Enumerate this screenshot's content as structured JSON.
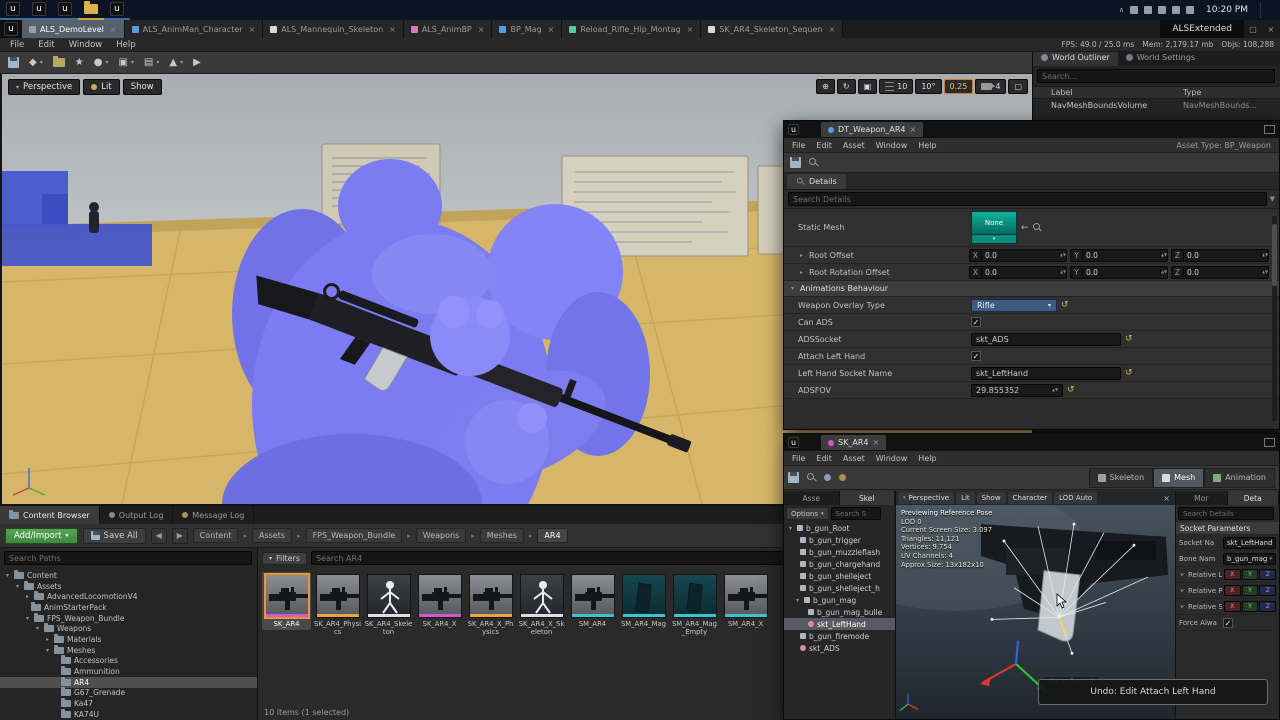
{
  "taskbar": {
    "clock": "10:20 PM",
    "window_title": "ALSExtended"
  },
  "editor_tabs": [
    {
      "label": "ALS_DemoLevel"
    },
    {
      "label": "ALS_AnimMan_Character"
    },
    {
      "label": "ALS_Mannequin_Skeleton"
    },
    {
      "label": "ALS_AnimBP"
    },
    {
      "label": "BP_Mag"
    },
    {
      "label": "Reload_Rifle_Hip_Montag"
    },
    {
      "label": "SK_AR4_Skeleton_Sequen"
    }
  ],
  "menu": [
    "File",
    "Edit",
    "Window",
    "Help"
  ],
  "perf": {
    "fps": "FPS: 49.0 / 25.0 ms",
    "mem": "Mem: 2,179.17 mb",
    "objs": "Objs: 108,288"
  },
  "viewport": {
    "perspective": "Perspective",
    "lit": "Lit",
    "show": "Show",
    "grid_snap": "10",
    "rot_snap": "10°",
    "scale_snap": "0.25",
    "camera_speed": "4"
  },
  "world_outliner": {
    "tab_outliner": "World Outliner",
    "tab_settings": "World Settings",
    "search_placeholder": "Search...",
    "col_label": "Label",
    "col_type": "Type",
    "rows": [
      {
        "label": "NavMeshBoundsVolume",
        "type": "NavMeshBounds..."
      }
    ]
  },
  "dt_window": {
    "title": "DT_Weapon_AR4",
    "menu": [
      "File",
      "Edit",
      "Asset",
      "Window",
      "Help"
    ],
    "asset_type": "Asset Type: BP_Weapon",
    "details_tab": "Details",
    "search_placeholder": "Search Details",
    "static_mesh_label": "Static Mesh",
    "static_mesh_value": "None",
    "root_offset_label": "Root Offset",
    "root_rotation_label": "Root Rotation Offset",
    "axes": [
      {
        "axis": "X",
        "value": "0.0"
      },
      {
        "axis": "Y",
        "value": "0.0"
      },
      {
        "axis": "Z",
        "value": "0.0"
      }
    ],
    "section_header": "Animations Behaviour",
    "rows": [
      {
        "label": "Weapon Overlay Type",
        "value": "Rifle"
      },
      {
        "label": "Can ADS"
      },
      {
        "label": "ADSSocket",
        "value": "skt_ADS"
      },
      {
        "label": "Attach Left Hand"
      },
      {
        "label": "Left Hand Socket Name",
        "value": "skt_LeftHand"
      },
      {
        "label": "ADSFOV",
        "value": "29.855352"
      }
    ]
  },
  "sk_window": {
    "title": "SK_AR4",
    "menu": [
      "File",
      "Edit",
      "Asset",
      "Window",
      "Help"
    ],
    "mode_tabs": [
      "Skeleton",
      "Mesh",
      "Animation"
    ],
    "left_tabs": [
      "Asse",
      "Skel"
    ],
    "options_label": "Options",
    "search_placeholder": "Search S",
    "bones": [
      {
        "label": "b_gun_Root"
      },
      {
        "label": "b_gun_trigger"
      },
      {
        "label": "b_gun_muzzleflash"
      },
      {
        "label": "b_gun_chargehand"
      },
      {
        "label": "b_gun_shelleject"
      },
      {
        "label": "b_gun_shelleject_h"
      },
      {
        "label": "b_gun_mag"
      },
      {
        "label": "b_gun_mag_bulle"
      },
      {
        "label": "skt_LeftHand"
      },
      {
        "label": "b_gun_firemode"
      },
      {
        "label": "skt_ADS"
      }
    ],
    "viewport_tabs": [
      "Perspective",
      "Lit",
      "Show",
      "Character",
      "LOD Auto"
    ],
    "overlay": [
      "Previewing Reference Pose",
      "LOD 0",
      "Current Screen Size: 3.097",
      "Triangles: 11,121",
      "Vertices: 9,754",
      "UV Channels: 4",
      "Approx Size: 13x182x10"
    ],
    "bone_label": "skt_LeftHand",
    "right_tabs": [
      "Mor",
      "Deta"
    ],
    "search_details_placeholder": "Search Details",
    "socket_header": "Socket Parameters",
    "socket_rows": [
      {
        "label": "Socket Na",
        "value": "skt_LeftHand"
      },
      {
        "label": "Bone Nam",
        "value": "b_gun_mag"
      },
      {
        "label": "Relative Lo"
      },
      {
        "label": "Relative Ro"
      },
      {
        "label": "Relative Sc"
      },
      {
        "label": "Force Alwa"
      }
    ]
  },
  "toast": {
    "text": "Undo: Edit Attach Left Hand"
  },
  "content_browser": {
    "tabs": [
      "Content Browser",
      "Output Log",
      "Message Log"
    ],
    "add_import": "Add/Import",
    "save_all": "Save All",
    "breadcrumbs": [
      "Content",
      "Assets",
      "FPS_Weapon_Bundle",
      "Weapons",
      "Meshes",
      "AR4"
    ],
    "search_paths_placeholder": "Search Paths",
    "folders": [
      {
        "label": "Content"
      },
      {
        "label": "Assets"
      },
      {
        "label": "AdvancedLocomotionV4"
      },
      {
        "label": "AnimStarterPack"
      },
      {
        "label": "FPS_Weapon_Bundle"
      },
      {
        "label": "Weapons"
      },
      {
        "label": "Materials"
      },
      {
        "label": "Meshes"
      },
      {
        "label": "Accessories"
      },
      {
        "label": "Ammunition"
      },
      {
        "label": "AR4"
      },
      {
        "label": "G67_Grenade"
      },
      {
        "label": "Ka47"
      },
      {
        "label": "KA74U"
      }
    ],
    "filters_label": "Filters",
    "search_assets_placeholder": "Search AR4",
    "assets": [
      {
        "name": "SK_AR4",
        "type": "skeletal"
      },
      {
        "name": "SK_AR4_Physics",
        "type": "physics"
      },
      {
        "name": "SK_AR4_Skeleton",
        "type": "skeleton"
      },
      {
        "name": "SK_AR4_X",
        "type": "skeletal"
      },
      {
        "name": "SK_AR4_X_Physics",
        "type": "physics"
      },
      {
        "name": "SK_AR4_X_Skeleton",
        "type": "skeleton"
      },
      {
        "name": "SM_AR4",
        "type": "static"
      },
      {
        "name": "SM_AR4_Mag",
        "type": "static"
      },
      {
        "name": "SM_AR4_Mag_Empty",
        "type": "static"
      },
      {
        "name": "SM_AR4_X",
        "type": "static"
      }
    ],
    "status": "10 items (1 selected)"
  },
  "colors": {
    "selection_orange": "#e8962e",
    "asset_skeletal": "#d257d2",
    "asset_physics": "#e8a33d",
    "asset_skeleton": "#dcdce8",
    "asset_static": "#3fc1d3",
    "viewport_character": "#7b7bf2",
    "floor": "#d6b76a"
  }
}
